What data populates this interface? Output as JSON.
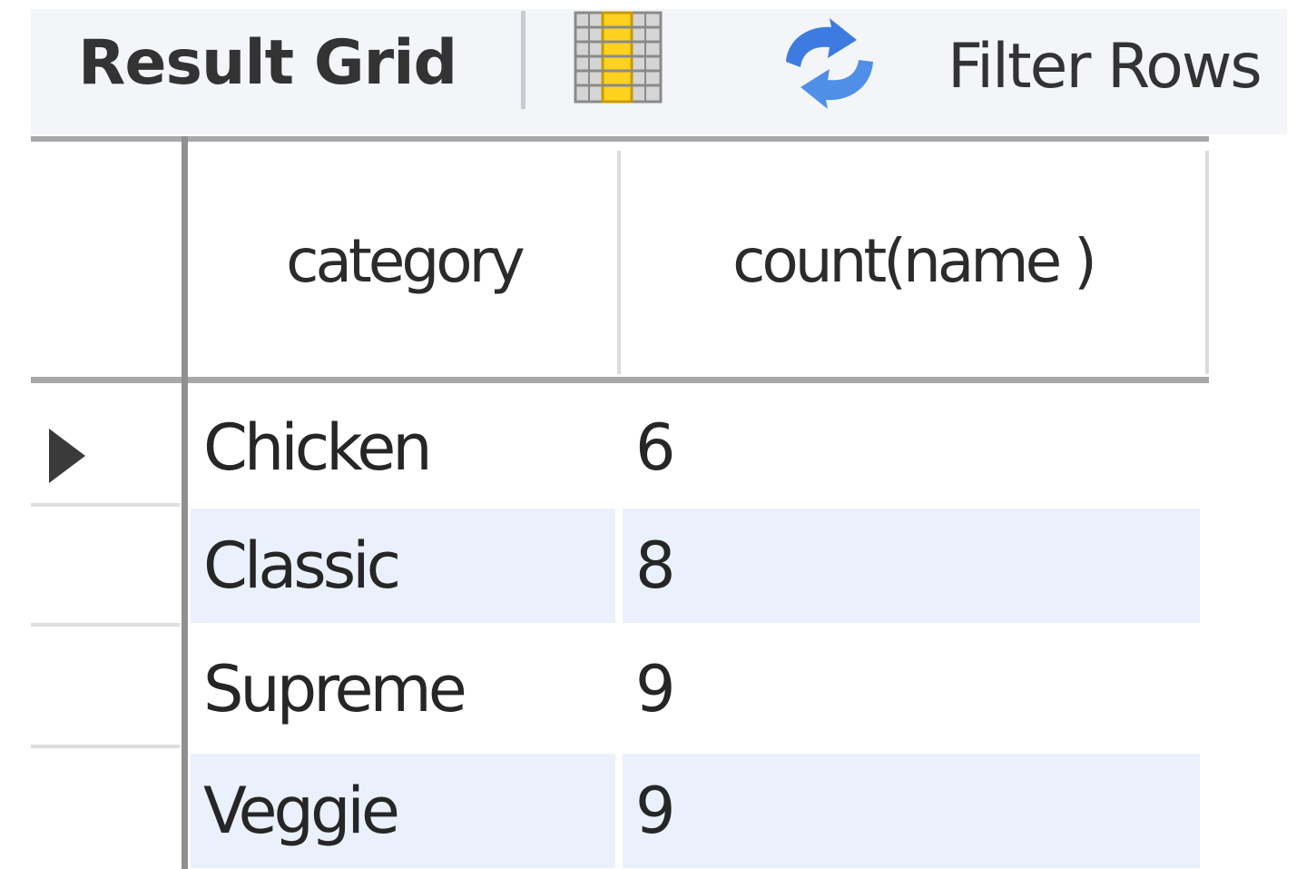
{
  "toolbar": {
    "title": "Result Grid",
    "grid_icon": "result-grid-toggle-icon",
    "refresh_icon": "refresh-icon",
    "filter_label": "Filter Rows"
  },
  "grid": {
    "columns": [
      {
        "label": "category"
      },
      {
        "label": "count(name )"
      }
    ],
    "rows": [
      {
        "category": "Chicken",
        "count": "6"
      },
      {
        "category": "Classic",
        "count": "8"
      },
      {
        "category": "Supreme",
        "count": "9"
      },
      {
        "category": "Veggie",
        "count": "9"
      }
    ],
    "selected_row_icon": "row-pointer-icon"
  },
  "colors": {
    "toolbar_bg": "#f3f5f9",
    "alt_row_bg": "#eaf1fc",
    "grid_icon_accent": "#ffd21f",
    "refresh_icon_blue": "#3d7be0"
  }
}
